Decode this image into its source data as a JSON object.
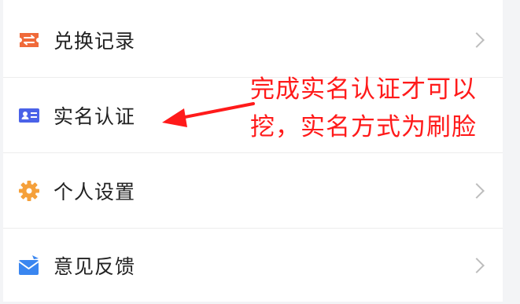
{
  "menu": {
    "items": [
      {
        "label": "兑换记录",
        "icon": "ticket-icon",
        "icon_color": "#f06a3a",
        "has_chevron": true
      },
      {
        "label": "实名认证",
        "icon": "id-card-icon",
        "icon_color": "#4a62e8",
        "has_chevron": false
      },
      {
        "label": "个人设置",
        "icon": "gear-icon",
        "icon_color": "#f5a03a",
        "has_chevron": true
      },
      {
        "label": "意见反馈",
        "icon": "envelope-icon",
        "icon_color": "#3a86f0",
        "has_chevron": true
      }
    ]
  },
  "annotation": {
    "line1": "完成实名认证才可以",
    "line2": "挖，实名方式为刷脸",
    "color": "#ff1a1a"
  }
}
